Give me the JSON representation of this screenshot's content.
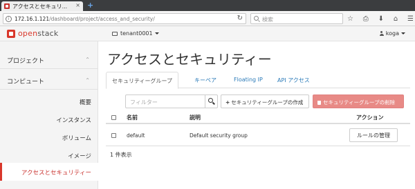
{
  "browser": {
    "tab_title": "アクセスとセキュリ...",
    "tab_close": "×",
    "new_tab": "+",
    "url_host": "172.16.1.121",
    "url_path": "/dashboard/project/access_and_security/",
    "reload": "↻",
    "search_placeholder": "検索",
    "nav_icons": [
      "☆",
      "⎙",
      "⬇",
      "⌂",
      "☰"
    ]
  },
  "header": {
    "logo_open": "open",
    "logo_stack": "stack",
    "project": "tenant0001",
    "user": "koga"
  },
  "sidebar": {
    "sections": [
      {
        "label": "プロジェクト",
        "chevron": "⌃"
      },
      {
        "label": "コンピュート",
        "chevron": "⌃"
      }
    ],
    "items": [
      {
        "label": "概要"
      },
      {
        "label": "インスタンス"
      },
      {
        "label": "ボリューム"
      },
      {
        "label": "イメージ"
      },
      {
        "label": "アクセスとセキュリティー"
      }
    ]
  },
  "main": {
    "title": "アクセスとセキュリティー",
    "tabs": [
      {
        "label": "セキュリティーグループ"
      },
      {
        "label": "キーペア"
      },
      {
        "label": "Floating IP"
      },
      {
        "label": "API アクセス"
      }
    ],
    "filter_placeholder": "フィルター",
    "create_button": "セキュリティーグループの作成",
    "delete_button": "セキュリティーグループの削除",
    "table": {
      "headers": [
        "名前",
        "説明",
        "アクション"
      ],
      "rows": [
        {
          "name": "default",
          "description": "Default security group",
          "action": "ルールの管理"
        }
      ]
    },
    "count": "1 件表示"
  }
}
